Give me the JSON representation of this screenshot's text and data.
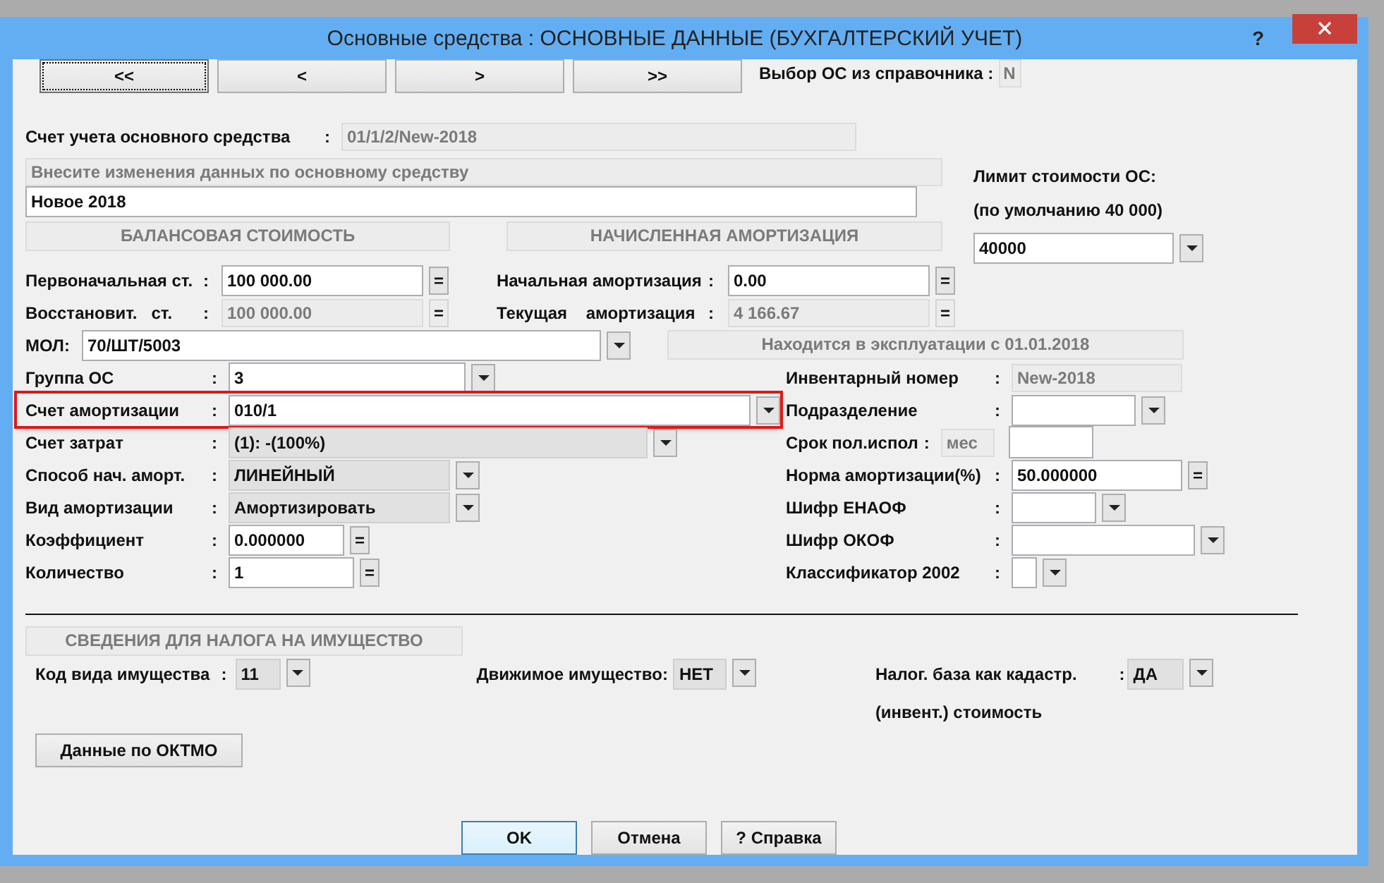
{
  "window": {
    "title": "Основные средства : ОСНОВНЫЕ ДАННЫЕ (БУХГАЛТЕРСКИЙ УЧЕТ)",
    "help": "?"
  },
  "nav_buttons": [
    {
      "label": "<<",
      "focused": true
    },
    {
      "label": "<",
      "focused": false
    },
    {
      "label": ">",
      "focused": false
    },
    {
      "label": ">>",
      "focused": false
    }
  ],
  "catalog_pick": {
    "label": "Выбор ОС из справочника :",
    "value": "N"
  },
  "account": {
    "label": "Счет учета основного средства",
    "colon": ":",
    "value": "01/1/2/New-2018"
  },
  "description": {
    "caption": "Внесите изменения данных по основному средству",
    "value": "Новое 2018"
  },
  "limit": {
    "label": "Лимит стоимости ОС:",
    "hint": "(по умолчанию 40 000)",
    "value": "40000"
  },
  "sections": [
    "БАЛАНСОВАЯ СТОИМОСТЬ",
    "НАЧИСЛЕННАЯ АМОРТИЗАЦИЯ"
  ],
  "cost_rows": [
    {
      "left": {
        "label": "Первоначальная ст.",
        "colon": ":",
        "value": "100 000.00",
        "readonly": false,
        "action": "="
      },
      "right": {
        "label": "Начальная амортизация",
        "colon": ":",
        "value": "0.00",
        "readonly": false,
        "action": "="
      }
    },
    {
      "left": {
        "label": "Восстановит.   ст.",
        "colon": ":",
        "value": "100 000.00",
        "readonly": true,
        "action": "="
      },
      "right": {
        "label": "Текущая    амортизация",
        "colon": ":",
        "value": "4 166.67",
        "readonly": true,
        "action": "="
      }
    }
  ],
  "mol": {
    "label": "МОЛ:",
    "value": "70/ШТ/5003"
  },
  "in_service": "Находится в эксплуатации с 01.01.2018",
  "left_fields": [
    {
      "kind": "combo",
      "label": "Группа ОС",
      "colon": ":",
      "value": "3",
      "highlighted": false
    },
    {
      "kind": "combo",
      "label": "Счет амортизации",
      "colon": ":",
      "value": "010/1",
      "highlighted": true
    },
    {
      "kind": "list",
      "label": "Счет затрат",
      "colon": ":",
      "value": "(1): -(100%)",
      "highlighted": false
    },
    {
      "kind": "list",
      "label": "Способ нач. аморт.",
      "colon": ":",
      "value": "ЛИНЕЙНЫЙ",
      "highlighted": false
    },
    {
      "kind": "list",
      "label": "Вид амортизации",
      "colon": ":",
      "value": "Амортизировать",
      "highlighted": false
    },
    {
      "kind": "number",
      "label": "Коэффициент",
      "colon": ":",
      "value": "0.000000",
      "action": "=",
      "highlighted": false
    },
    {
      "kind": "number",
      "label": "Количество",
      "colon": ":",
      "value": "1",
      "action": "=",
      "highlighted": false
    }
  ],
  "right_fields": [
    {
      "kind": "readonly",
      "label": "Инвентарный номер",
      "colon": ":",
      "value": "New-2018"
    },
    {
      "kind": "combo",
      "label": "Подразделение",
      "colon": ":"
    },
    {
      "kind": "term",
      "label": "Срок пол.испол",
      "colon": ":",
      "unit": "мес"
    },
    {
      "kind": "number",
      "label": "Норма амортизации(%)",
      "colon": ":",
      "value": "50.000000",
      "action": "="
    },
    {
      "kind": "combo",
      "label": "Шифр ЕНАОФ",
      "colon": ":"
    },
    {
      "kind": "combo",
      "label": "Шифр ОКОФ",
      "colon": ":"
    },
    {
      "kind": "combo",
      "label": "Классификатор 2002",
      "colon": ":"
    }
  ],
  "tax": {
    "title": "СВЕДЕНИЯ ДЛЯ НАЛОГА НА ИМУЩЕСТВО",
    "items": [
      {
        "label": "Код вида имущества",
        "colon": ":",
        "value": "11"
      },
      {
        "label": "Движимое имущество:",
        "value": "НЕТ"
      },
      {
        "label": "Налог. база как кадастр.",
        "label2": "(инвент.) стоимость",
        "colon": ":",
        "value": "ДА"
      }
    ],
    "button": "Данные по ОКТМО"
  },
  "buttons": [
    {
      "label": "OK",
      "default": true
    },
    {
      "label": "Отмена",
      "default": false
    },
    {
      "label": "? Справка",
      "default": false
    }
  ]
}
